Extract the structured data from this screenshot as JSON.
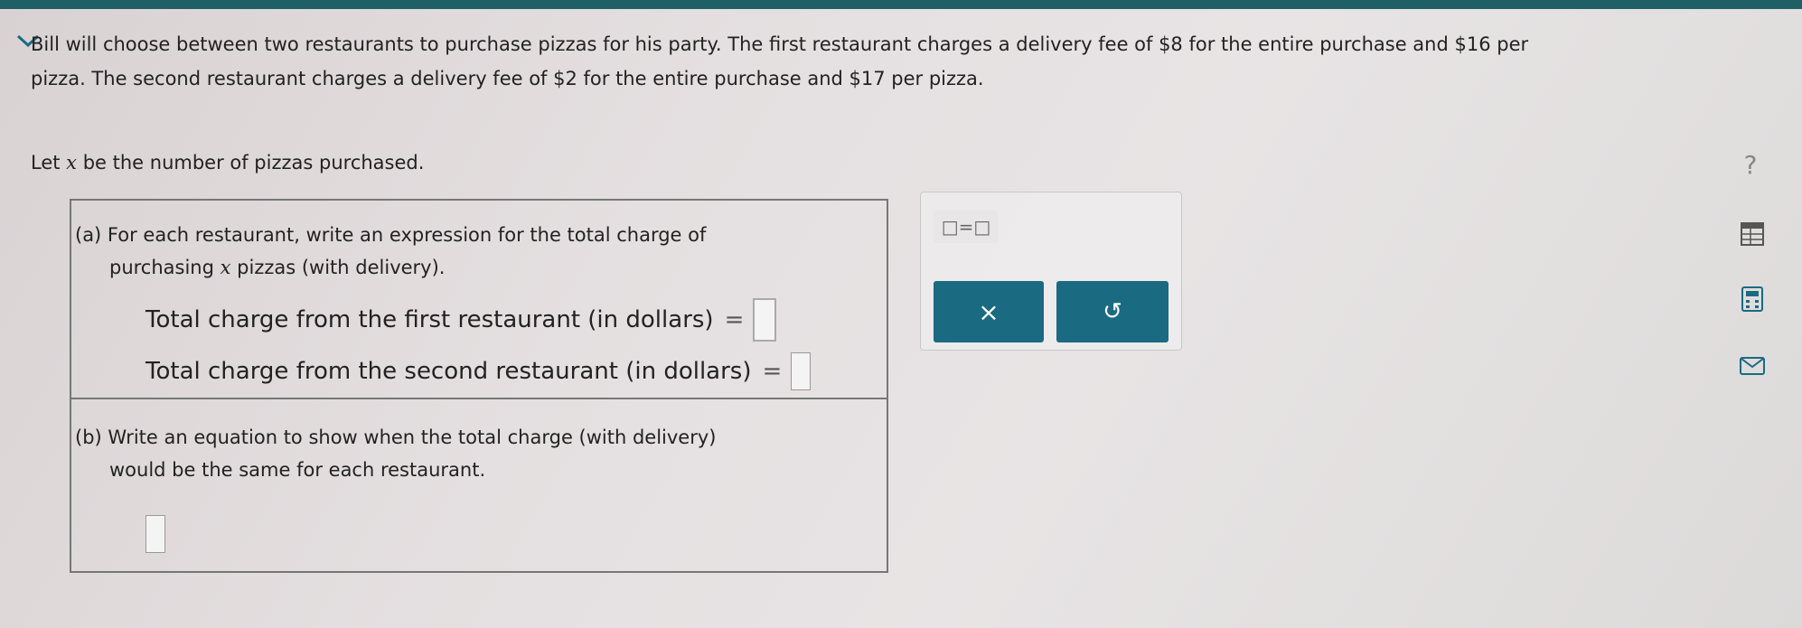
{
  "header": {
    "collapse_icon": "chevron-down-icon"
  },
  "question": {
    "line1": "Bill will choose between two restaurants to purchase pizzas for his party. The first restaurant charges a delivery fee of $8 for the entire purchase and $16 per",
    "line2": "pizza. The second restaurant charges a delivery fee of $2 for the entire purchase and $17 per pizza.",
    "let_prefix": "Let ",
    "let_var": "x",
    "let_suffix": " be the number of pizzas purchased."
  },
  "part_a": {
    "line1": "(a) For each restaurant, write an expression for the total charge of",
    "line2_prefix": "purchasing ",
    "line2_var": "x",
    "line2_suffix": " pizzas (with delivery).",
    "first_label": "Total charge from the first restaurant (in dollars)",
    "second_label": "Total charge from the second restaurant (in dollars)",
    "equals": "="
  },
  "part_b": {
    "line1": "(b) Write an equation to show when the total charge (with delivery)",
    "line2": "would be the same for each restaurant."
  },
  "tools": {
    "equation_template": "□=□",
    "clear_symbol": "×",
    "undo_symbol": "↺"
  },
  "side": {
    "help_symbol": "?"
  },
  "colors": {
    "accent": "#1a6a82",
    "top_bar": "#1f5f66"
  }
}
